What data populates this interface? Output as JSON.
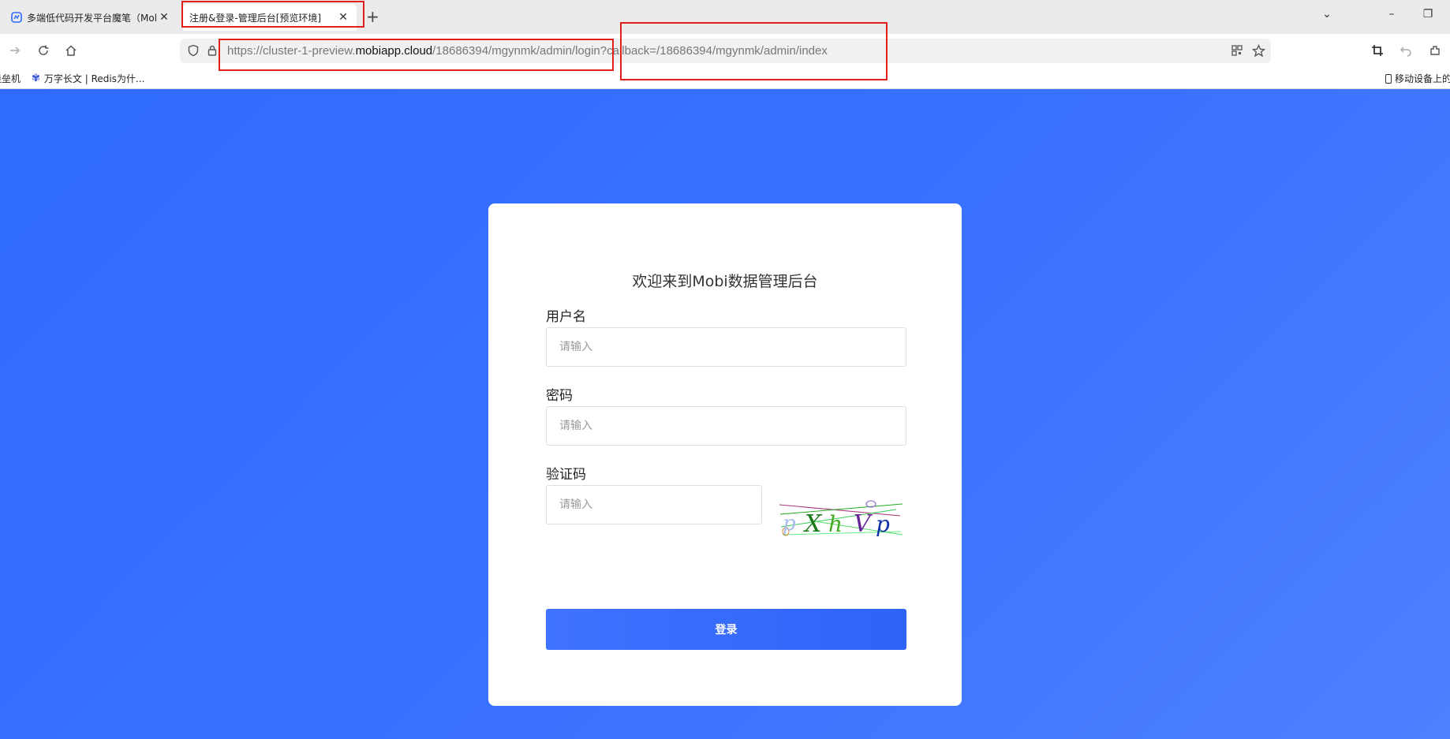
{
  "browser": {
    "tabs": [
      {
        "label": "多端低代码开发平台魔笔（Mol",
        "active": false
      },
      {
        "label": "注册&登录-管理后台[预览环境]",
        "active": true
      }
    ],
    "new_tab_label": "+",
    "url": {
      "prefix": "https://cluster-1-preview.",
      "host": "mobiapp.cloud",
      "path": "/18686394/mgynmk/admin/login?callback=/18686394/mgynmk/admin/index"
    },
    "bookmarks": [
      {
        "label": "堡垒机",
        "icon": "folder-icon"
      },
      {
        "label": "万字长文 | Redis为什...",
        "icon": "paw-icon"
      }
    ],
    "bookmarks_right": "移动设备上的"
  },
  "login": {
    "title": "欢迎来到Mobi数据管理后台",
    "username": {
      "label": "用户名",
      "value": "",
      "placeholder": "请输入"
    },
    "password": {
      "label": "密码",
      "value": "",
      "placeholder": "请输入"
    },
    "captcha": {
      "label": "验证码",
      "value": "",
      "placeholder": "请输入",
      "image_text": "pXhVp"
    },
    "submit_label": "登录"
  },
  "colors": {
    "page_background": "#3370ff",
    "button": "#3169fb",
    "highlight": "#e0201b"
  }
}
